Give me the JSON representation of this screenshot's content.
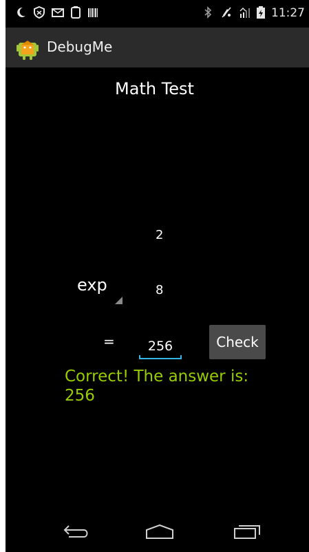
{
  "status_bar": {
    "time": "11:27",
    "icons": [
      "moon-icon",
      "shield-icon",
      "mail-icon",
      "phone-icon",
      "barcode-icon",
      "bluetooth-icon",
      "mute-icon",
      "signal-icon",
      "battery-icon"
    ]
  },
  "action_bar": {
    "app_title": "DebugMe",
    "app_icon": "android-icon"
  },
  "content": {
    "title": "Math Test",
    "operand1": "2",
    "operator": "exp",
    "operand2": "8",
    "equals": "=",
    "answer": "256",
    "check_label": "Check",
    "result_line1": "Correct! The answer is:",
    "result_line2": "256"
  },
  "nav_bar": {
    "buttons": [
      "back-icon",
      "home-icon",
      "recents-icon"
    ]
  },
  "colors": {
    "background": "#000000",
    "action_bar": "#2b2b2b",
    "result_text": "#99cc00",
    "accent": "#33b5e5",
    "button": "#4a4a4a"
  }
}
